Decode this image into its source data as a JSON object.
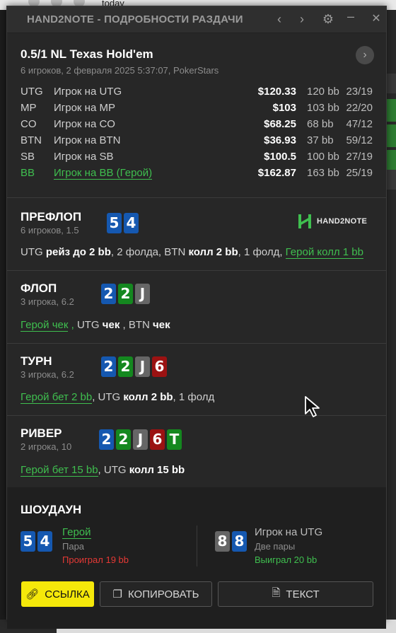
{
  "background": {
    "top_label": "today"
  },
  "window": {
    "title": "HAND2NOTE - ПОДРОБНОСТИ РАЗДАЧИ",
    "icons": [
      "chevron-left-icon",
      "chevron-right-icon",
      "gear-icon",
      "minimize-icon",
      "close-icon"
    ]
  },
  "hand": {
    "game": "0.5/1 NL Texas Hold'em",
    "subtitle": "6 игроков, 2 февраля 2025 5:37:07, PokerStars",
    "players": [
      {
        "pos": "UTG",
        "name": "Игрок на UTG",
        "stack": "$120.33",
        "bb": "120 bb",
        "stats": "23/19"
      },
      {
        "pos": "MP",
        "name": "Игрок на MP",
        "stack": "$103",
        "bb": "103 bb",
        "stats": "22/20"
      },
      {
        "pos": "CO",
        "name": "Игрок на CO",
        "stack": "$68.25",
        "bb": "68 bb",
        "stats": "47/12"
      },
      {
        "pos": "BTN",
        "name": "Игрок на BTN",
        "stack": "$36.93",
        "bb": "37 bb",
        "stats": "59/12"
      },
      {
        "pos": "SB",
        "name": "Игрок на SB",
        "stack": "$100.5",
        "bb": "100 bb",
        "stats": "27/19"
      },
      {
        "pos": "BB",
        "name": "Игрок на BB (Герой)",
        "stack": "$162.87",
        "bb": "163 bb",
        "stats": "25/19",
        "hero": true
      }
    ],
    "dot": "·"
  },
  "logo_text": "HAND2NOTE",
  "streets": {
    "preflop": {
      "name": "ПРЕФЛОП",
      "sub": "6 игроков, 1.5",
      "cards": [
        {
          "r": "5",
          "c": "blue"
        },
        {
          "r": "4",
          "c": "blue"
        }
      ],
      "a1": "UTG ",
      "a2": "рейз до 2 bb",
      "a3": ", 2 фолда, BTN ",
      "a4": "колл 2 bb",
      "a5": ", 1 фолд, ",
      "a6": "Герой колл 1 bb"
    },
    "flop": {
      "name": "ФЛОП",
      "sub": "3 игрока, 6.2",
      "cards": [
        {
          "r": "2",
          "c": "blue"
        },
        {
          "r": "2",
          "c": "green"
        },
        {
          "r": "J",
          "c": "gray"
        }
      ],
      "a1": "Герой чек",
      "a2": " , ",
      "a3": "UTG ",
      "a4": "чек",
      "a5": " , BTN ",
      "a6": "чек"
    },
    "turn": {
      "name": "ТУРН",
      "sub": "3 игрока, 6.2",
      "cards": [
        {
          "r": "2",
          "c": "blue"
        },
        {
          "r": "2",
          "c": "green"
        },
        {
          "r": "J",
          "c": "gray"
        },
        {
          "r": "6",
          "c": "red"
        }
      ],
      "a1": "Герой бет 2 bb",
      "a2": ", UTG ",
      "a3": "колл 2 bb",
      "a4": ", 1 фолд"
    },
    "river": {
      "name": "РИВЕР",
      "sub": "2 игрока, 10",
      "cards": [
        {
          "r": "2",
          "c": "blue"
        },
        {
          "r": "2",
          "c": "green"
        },
        {
          "r": "J",
          "c": "gray"
        },
        {
          "r": "6",
          "c": "red"
        },
        {
          "r": "T",
          "c": "green"
        }
      ],
      "a1": "Герой бет 15 bb",
      "a2": ", UTG ",
      "a3": "колл 15 bb"
    }
  },
  "showdown": {
    "title": "ШОУДАУН",
    "hero": {
      "cards": [
        {
          "r": "5",
          "c": "blue"
        },
        {
          "r": "4",
          "c": "blue"
        }
      ],
      "name": "Герой",
      "hand": "Пара",
      "result": "Проиграл 19 bb"
    },
    "villain": {
      "cards": [
        {
          "r": "8",
          "c": "gray"
        },
        {
          "r": "8",
          "c": "blue"
        }
      ],
      "name": "Игрок на UTG",
      "hand": "Две пары",
      "result": "Выиграл 20 bb"
    }
  },
  "buttons": {
    "link": "ССЫЛКА",
    "copy": "КОПИРОВАТЬ",
    "text": "ТЕКСТ"
  },
  "colors": {
    "accent_green": "#3fbf4f",
    "loss_red": "#e53935",
    "yellow": "#f5e80a",
    "card_blue": "#1558b0",
    "card_green": "#14881f",
    "card_gray": "#666666",
    "card_red": "#9b1212"
  }
}
